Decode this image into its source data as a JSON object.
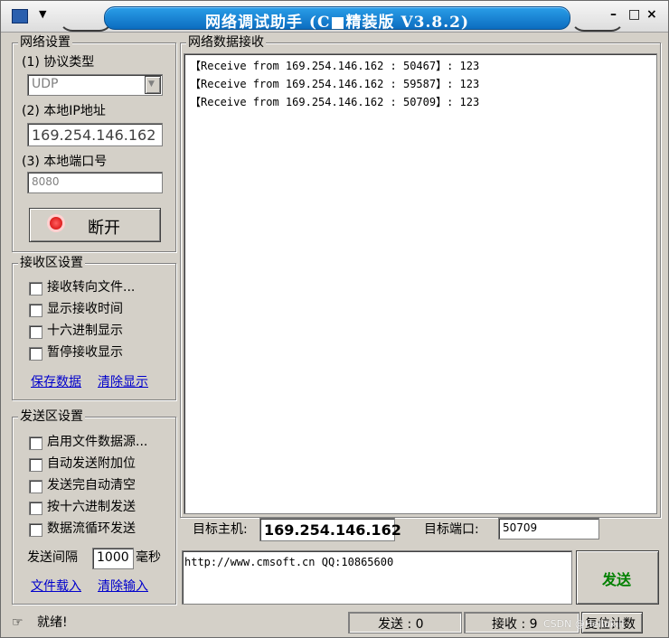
{
  "window": {
    "title": "网络调试助手 (C■精装版 V3.8.2)",
    "min_label": "–",
    "max_label": "□",
    "close_label": "×"
  },
  "net_settings": {
    "group_label": "网络设置",
    "protocol_label": "(1) 协议类型",
    "protocol_value": "UDP",
    "local_ip_label": "(2) 本地IP地址",
    "local_ip_value": "169.254.146.162",
    "local_port_label": "(3) 本地端口号",
    "local_port_value": "8080",
    "disconnect_label": "断开"
  },
  "recv_settings": {
    "group_label": "接收区设置",
    "options": [
      {
        "label": "接收转向文件..."
      },
      {
        "label": "显示接收时间"
      },
      {
        "label": "十六进制显示"
      },
      {
        "label": "暂停接收显示"
      }
    ],
    "save_link": "保存数据",
    "clear_link": "清除显示"
  },
  "send_settings": {
    "group_label": "发送区设置",
    "options": [
      {
        "label": "启用文件数据源..."
      },
      {
        "label": "自动发送附加位"
      },
      {
        "label": "发送完自动清空"
      },
      {
        "label": "按十六进制发送"
      },
      {
        "label": "数据流循环发送"
      }
    ],
    "interval_label": "发送间隔",
    "interval_value": "1000",
    "interval_unit": "毫秒",
    "load_file_link": "文件载入",
    "clear_input_link": "清除输入"
  },
  "recv_area": {
    "group_label": "网络数据接收",
    "lines": [
      "【Receive from 169.254.146.162 : 50467】: 123",
      "【Receive from 169.254.146.162 : 59587】: 123",
      "【Receive from 169.254.146.162 : 50709】: 123"
    ]
  },
  "target": {
    "host_label": "目标主机:",
    "host_value": "169.254.146.162",
    "port_label": "目标端口:",
    "port_value": "50709"
  },
  "send_area": {
    "text": "http://www.cmsoft.cn QQ:10865600",
    "send_button": "发送"
  },
  "status": {
    "ready": "就绪!",
    "sent": "发送 : 0",
    "received": "接收 : 9",
    "reset": "复位计数",
    "watermark": "CSDN @Hellokill"
  },
  "colors": {
    "title_bar": "#0c6dc0",
    "disconnect_icon": "#e00000",
    "send_button_text": "#008000",
    "link": "#0000cc"
  }
}
